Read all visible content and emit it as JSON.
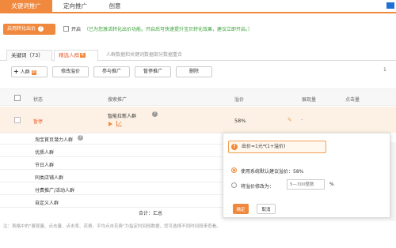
{
  "top_tabs": [
    {
      "label": "关键词推广"
    },
    {
      "label": "定向推广"
    },
    {
      "label": "创意"
    }
  ],
  "conversion": {
    "button_label": "启用转化出价",
    "help": "?",
    "toggle_label": "开启",
    "note": "（已为您激活转化出价功能。开启后可快速提升宝贝转化效果，建议立即开启。）"
  },
  "sub_tabs": {
    "keywords": "关键词（73）",
    "crowd": "精选人群",
    "new_badge": "新",
    "note": "人群数据和关键词数据部分数据重合"
  },
  "toolbar": {
    "add_plus": "+",
    "add_label": "人群",
    "add_badge": "新",
    "edit_price": "修改溢价",
    "join_promo": "参与推广",
    "pause_promo": "暂停推广",
    "delete": "删除",
    "right_more": "1"
  },
  "table": {
    "headers": {
      "status": "状态",
      "name": "搜索推广",
      "premium": "溢价",
      "impressions": "展现量",
      "clicks": "点击量"
    },
    "rows": [
      {
        "status": "暂停",
        "name": "智能拉新人群",
        "help": "?",
        "premium": "58%",
        "impressions": "-"
      }
    ],
    "crowd_list": [
      "淘宝首页潜力人群",
      "优质人群",
      "节日人群",
      "同类店铺人群",
      "付费推广/活动人群",
      "自定义人群"
    ],
    "crowd_help": "?",
    "total": "合计：汇总"
  },
  "footnote": "注：表格中的\"展现量、点击量、点击率、花费、平均点击花费\"为指定时间段数据，您可选择不同时间段来查看。",
  "popup": {
    "warn_icon": "!",
    "formula": "出价=1元*(1+溢价)",
    "option_default": "使用系统默认建议溢价：58%",
    "option_custom": "将溢价修改为：",
    "input_placeholder": "5—300整数",
    "unit": "%",
    "ok": "确定",
    "cancel": "取消"
  },
  "colors": {
    "accent": "#f0893e",
    "green_note": "#3aa03a",
    "row_highlight": "#fcf1e4"
  }
}
